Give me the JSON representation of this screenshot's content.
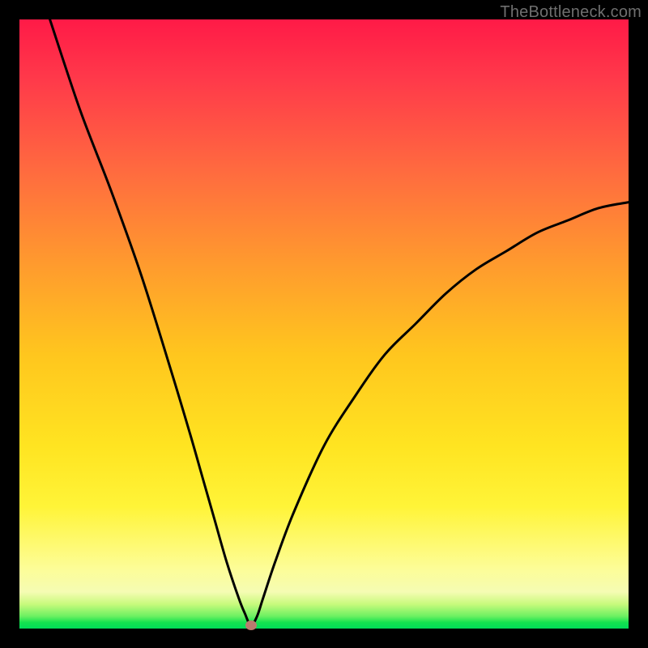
{
  "watermark": "TheBottleneck.com",
  "chart_data": {
    "type": "line",
    "title": "",
    "xlabel": "",
    "ylabel": "",
    "xlim": [
      0,
      100
    ],
    "ylim": [
      0,
      100
    ],
    "grid": false,
    "legend_position": "none",
    "description": "V-shaped bottleneck curve over a red-to-green vertical gradient. The curve descends sharply from top-left, reaches a minimum near x≈38 at y≈0, then rises with decreasing slope toward the right edge at roughly y≈70. A small oval marker sits at the minimum.",
    "series": [
      {
        "name": "bottleneck-curve",
        "x": [
          5,
          10,
          15,
          20,
          25,
          28,
          30,
          32,
          34,
          36,
          37,
          38,
          39,
          40,
          42,
          45,
          50,
          55,
          60,
          65,
          70,
          75,
          80,
          85,
          90,
          95,
          100
        ],
        "y": [
          100,
          85,
          72,
          58,
          42,
          32,
          25,
          18,
          11,
          5,
          2.5,
          0.5,
          2,
          5,
          11,
          19,
          30,
          38,
          45,
          50,
          55,
          59,
          62,
          65,
          67,
          69,
          70
        ]
      }
    ],
    "marker": {
      "x": 38,
      "y": 0.5
    },
    "gradient_stops": [
      {
        "pos": 0,
        "color": "#ff1a47"
      },
      {
        "pos": 25,
        "color": "#ff6b3f"
      },
      {
        "pos": 55,
        "color": "#ffc61e"
      },
      {
        "pos": 80,
        "color": "#fff438"
      },
      {
        "pos": 94,
        "color": "#f5fcb3"
      },
      {
        "pos": 98,
        "color": "#6af061"
      },
      {
        "pos": 100,
        "color": "#00dc58"
      }
    ]
  }
}
